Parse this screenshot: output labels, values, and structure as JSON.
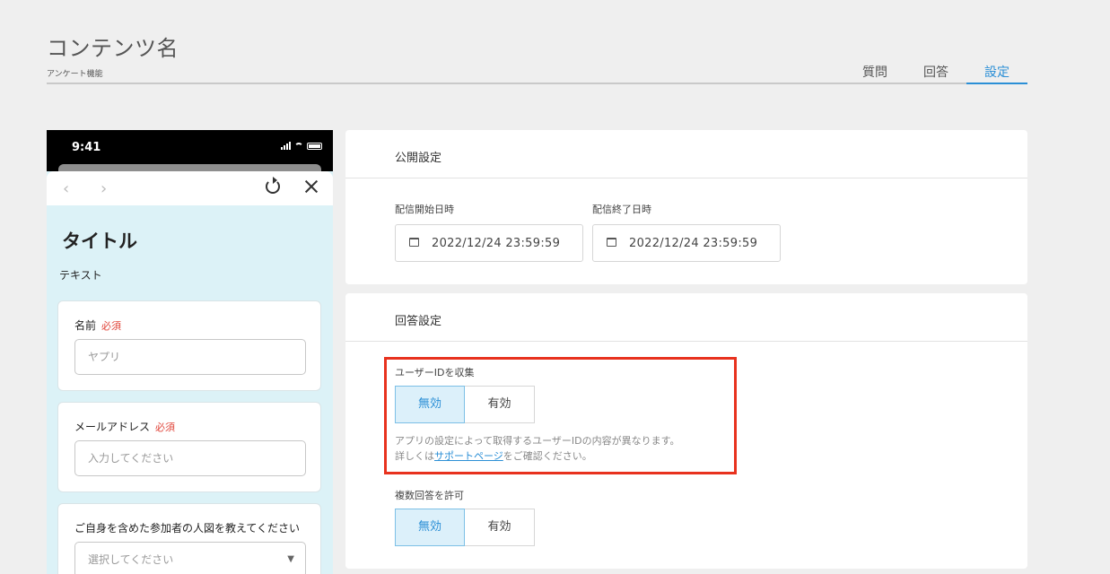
{
  "header": {
    "title": "コンテンツ名",
    "subtitle": "アンケート機能",
    "tabs": [
      {
        "label": "質問",
        "active": false
      },
      {
        "label": "回答",
        "active": false
      },
      {
        "label": "設定",
        "active": true
      }
    ],
    "accent_color": "#2b8fd6"
  },
  "preview": {
    "status_time": "9:41",
    "title": "タイトル",
    "text": "テキスト",
    "questions": [
      {
        "label": "名前",
        "required": "必須",
        "placeholder": "ヤプリ"
      },
      {
        "label": "メールアドレス",
        "required": "必須",
        "placeholder": "入力してください"
      },
      {
        "label": "ご自身を含めた参加者の人図を教えてください",
        "required": "",
        "placeholder": "選択してください",
        "arrow": "▼"
      }
    ],
    "nav_back": "‹",
    "nav_forward": "›"
  },
  "publish": {
    "title": "公開設定",
    "start_label": "配信開始日時",
    "start_value": "2022/12/24  23:59:59",
    "end_label": "配信終了日時",
    "end_value": "2022/12/24  23:59:59"
  },
  "answer": {
    "title": "回答設定",
    "collect_label": "ユーザーIDを収集",
    "collect_options": [
      "無効",
      "有効"
    ],
    "help_line1": "アプリの設定によって取得するユーザーIDの内容が異なります。",
    "help_prefix": "詳しくは",
    "help_link": "サポートページ",
    "help_suffix": "をご確認ください。",
    "multiple_label": "複数回答を許可",
    "multiple_options": [
      "無効",
      "有効"
    ]
  }
}
